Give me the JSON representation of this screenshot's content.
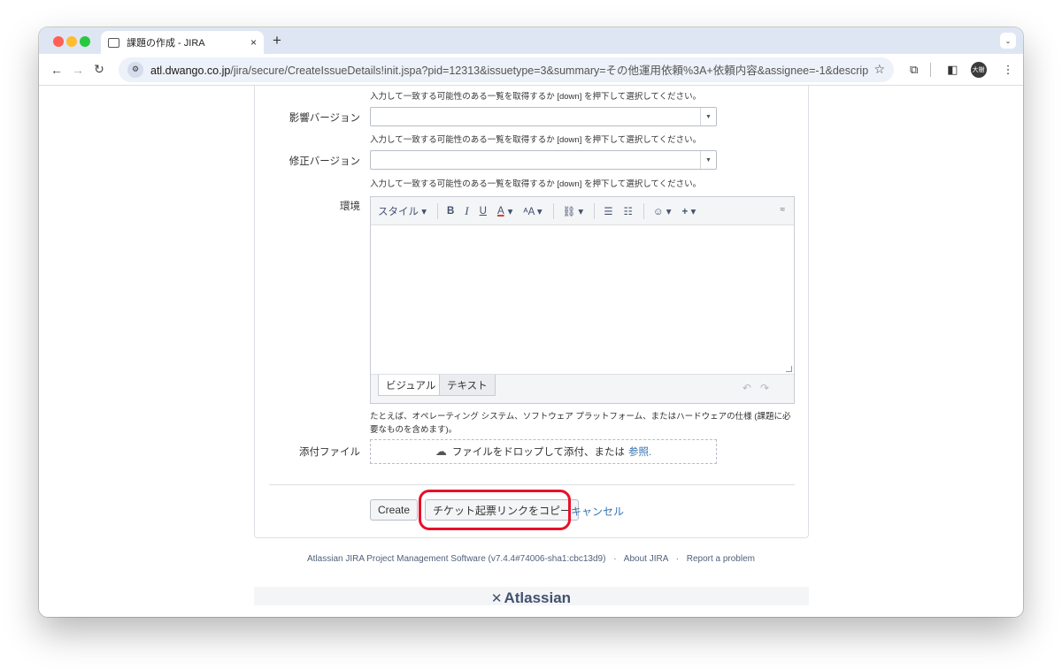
{
  "browser": {
    "tab_title": "課題の作成 - JIRA",
    "tab_close": "×",
    "new_tab": "+",
    "tab_menu": "⌄",
    "url_host": "atl.dwango.co.jp",
    "url_rest": "/jira/secure/CreateIssueDetails!init.jspa?pid=12313&issuetype=3&summary=その他運用依頼%3A+依頼内容&assignee=-1&description=※+依頼時…",
    "avatar_text": "大樹"
  },
  "form": {
    "hint_text": "入力して一致する可能性のある一覧を取得するか [down] を押下して選択してください。",
    "affects_version_label": "影響バージョン",
    "fix_version_label": "修正バージョン",
    "environment_label": "環境",
    "editor": {
      "style_label": "スタイル ▾",
      "bold": "B",
      "italic": "I",
      "underline": "U",
      "text_color": "A",
      "caret": "▾",
      "font_size": "ᴬA ▾",
      "link": "⛓ ▾",
      "bullet_list": "☰",
      "number_list": "☷",
      "emoticon": "☺ ▾",
      "insert_more": "+ ▾",
      "collapse": "≈",
      "visual_tab": "ビジュアル",
      "text_tab": "テキスト"
    },
    "environment_hint": "たとえば、オペレーティング システム、ソフトウェア プラットフォーム、またはハードウェアの仕様 (課題に必要なものを含めます)。",
    "attachment_label": "添付ファイル",
    "dropzone_text": "ファイルをドロップして添付、または",
    "dropzone_link": "参照.",
    "create_button": "Create",
    "copy_link_button": "チケット起票リンクをコピー",
    "cancel_link": "キャンセル"
  },
  "footer": {
    "software": "Atlassian JIRA Project Management Software (v7.4.4#74006-sha1:cbc13d9)",
    "separator": "·",
    "about": "About JIRA",
    "report": "Report a problem",
    "logo_text": "Atlassian"
  }
}
